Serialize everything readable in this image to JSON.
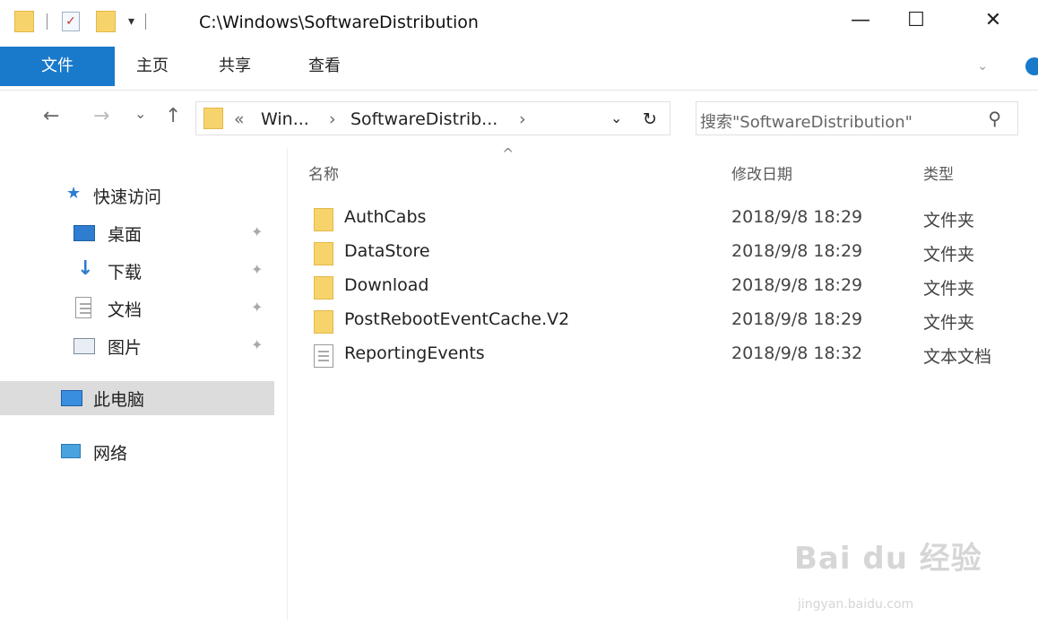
{
  "window": {
    "title": "C:\\Windows\\SoftwareDistribution",
    "controls": {
      "minimize": "—",
      "maximize": "☐",
      "close": "✕"
    }
  },
  "ribbon": {
    "tabs": [
      "文件",
      "主页",
      "共享",
      "查看"
    ]
  },
  "address": {
    "back": "←",
    "forward": "→",
    "recent": "⌄",
    "up": "↑",
    "crumbs": [
      "«",
      "Win...",
      "›",
      "SoftwareDistrib...",
      "›"
    ],
    "refresh": "↻",
    "dropdown": "⌄",
    "search_placeholder": "搜索\"SoftwareDistribution\""
  },
  "sidebar": {
    "quick_access": "快速访问",
    "items": [
      {
        "label": "桌面",
        "icon": "desktop-icon",
        "pinned": true
      },
      {
        "label": "下载",
        "icon": "download-icon",
        "pinned": true
      },
      {
        "label": "文档",
        "icon": "document-icon",
        "pinned": true
      },
      {
        "label": "图片",
        "icon": "pictures-icon",
        "pinned": true
      }
    ],
    "this_pc": "此电脑",
    "network": "网络"
  },
  "columns": {
    "name": "名称",
    "modified": "修改日期",
    "type": "类型",
    "sort_arrow": "^"
  },
  "files": [
    {
      "name": "AuthCabs",
      "date": "2018/9/8 18:29",
      "type": "文件夹",
      "icon": "folder-icon"
    },
    {
      "name": "DataStore",
      "date": "2018/9/8 18:29",
      "type": "文件夹",
      "icon": "folder-icon"
    },
    {
      "name": "Download",
      "date": "2018/9/8 18:29",
      "type": "文件夹",
      "icon": "folder-icon"
    },
    {
      "name": "PostRebootEventCache.V2",
      "date": "2018/9/8 18:29",
      "type": "文件夹",
      "icon": "folder-icon"
    },
    {
      "name": "ReportingEvents",
      "date": "2018/9/8 18:32",
      "type": "文本文档",
      "icon": "text-document-icon"
    }
  ],
  "watermark": {
    "brand": "Bai du 经验",
    "url": "jingyan.baidu.com"
  },
  "colors": {
    "accent": "#1979ca",
    "folder": "#f7d46b",
    "selected_bg": "#dcdcdc"
  }
}
